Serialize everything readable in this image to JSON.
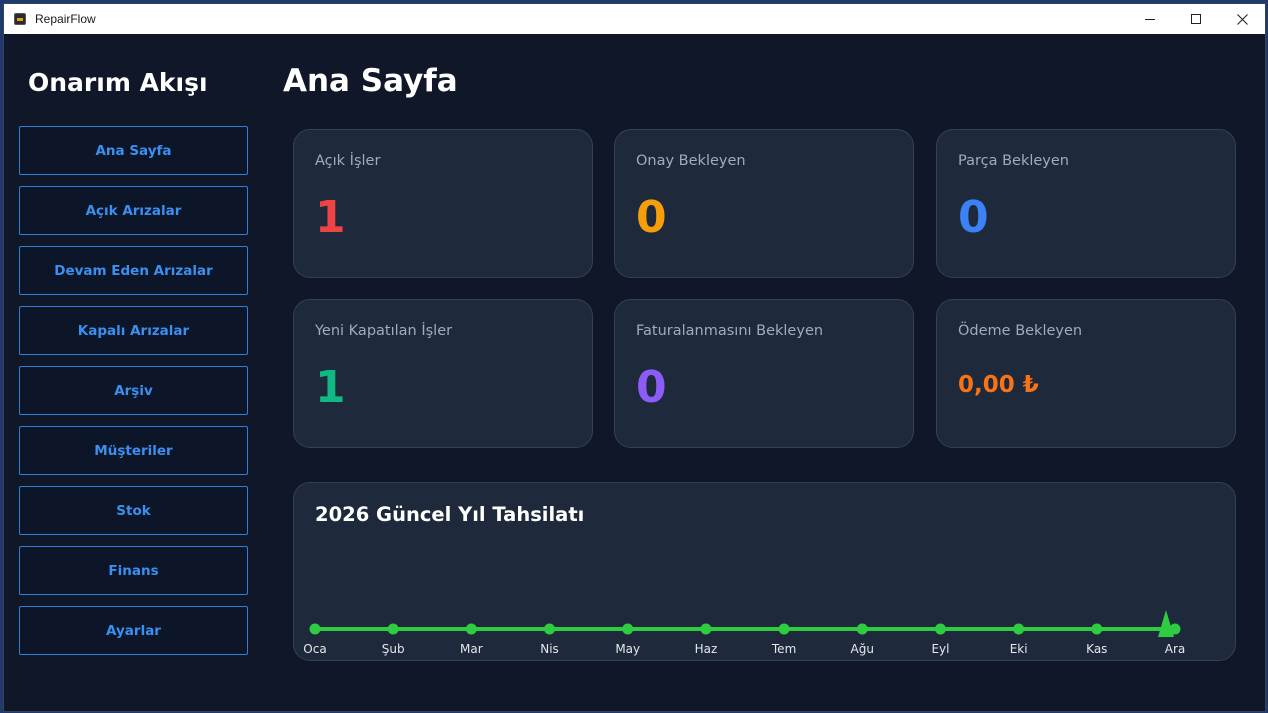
{
  "window": {
    "title": "RepairFlow"
  },
  "sidebar": {
    "brand": "Onarım Akışı",
    "items": [
      {
        "label": "Ana Sayfa"
      },
      {
        "label": "Açık Arızalar"
      },
      {
        "label": "Devam Eden Arızalar"
      },
      {
        "label": "Kapalı Arızalar"
      },
      {
        "label": "Arşiv"
      },
      {
        "label": "Müşteriler"
      },
      {
        "label": "Stok"
      },
      {
        "label": "Finans"
      },
      {
        "label": "Ayarlar"
      }
    ]
  },
  "main": {
    "title": "Ana Sayfa",
    "cards": [
      {
        "label": "Açık İşler",
        "value": "1",
        "color": "#ef4444"
      },
      {
        "label": "Onay Bekleyen",
        "value": "0",
        "color": "#f59e0b"
      },
      {
        "label": "Parça Bekleyen",
        "value": "0",
        "color": "#3b82f6"
      },
      {
        "label": "Yeni Kapatılan İşler",
        "value": "1",
        "color": "#10b981"
      },
      {
        "label": "Faturalanmasını Bekleyen",
        "value": "0",
        "color": "#8b5cf6"
      },
      {
        "label": "Ödeme Bekleyen",
        "value": "0,00 ₺",
        "color": "#f97316"
      }
    ]
  },
  "chart_data": {
    "type": "line",
    "title": "2026 Güncel Yıl Tahsilatı",
    "categories": [
      "Oca",
      "Şub",
      "Mar",
      "Nis",
      "May",
      "Haz",
      "Tem",
      "Ağu",
      "Eyl",
      "Eki",
      "Kas",
      "Ara"
    ],
    "series": [
      {
        "values": [
          0,
          0,
          0,
          0,
          0,
          0,
          0,
          0,
          0,
          0,
          0,
          0
        ],
        "color": "#2ecc40"
      }
    ],
    "grid": false,
    "legend": "none"
  }
}
